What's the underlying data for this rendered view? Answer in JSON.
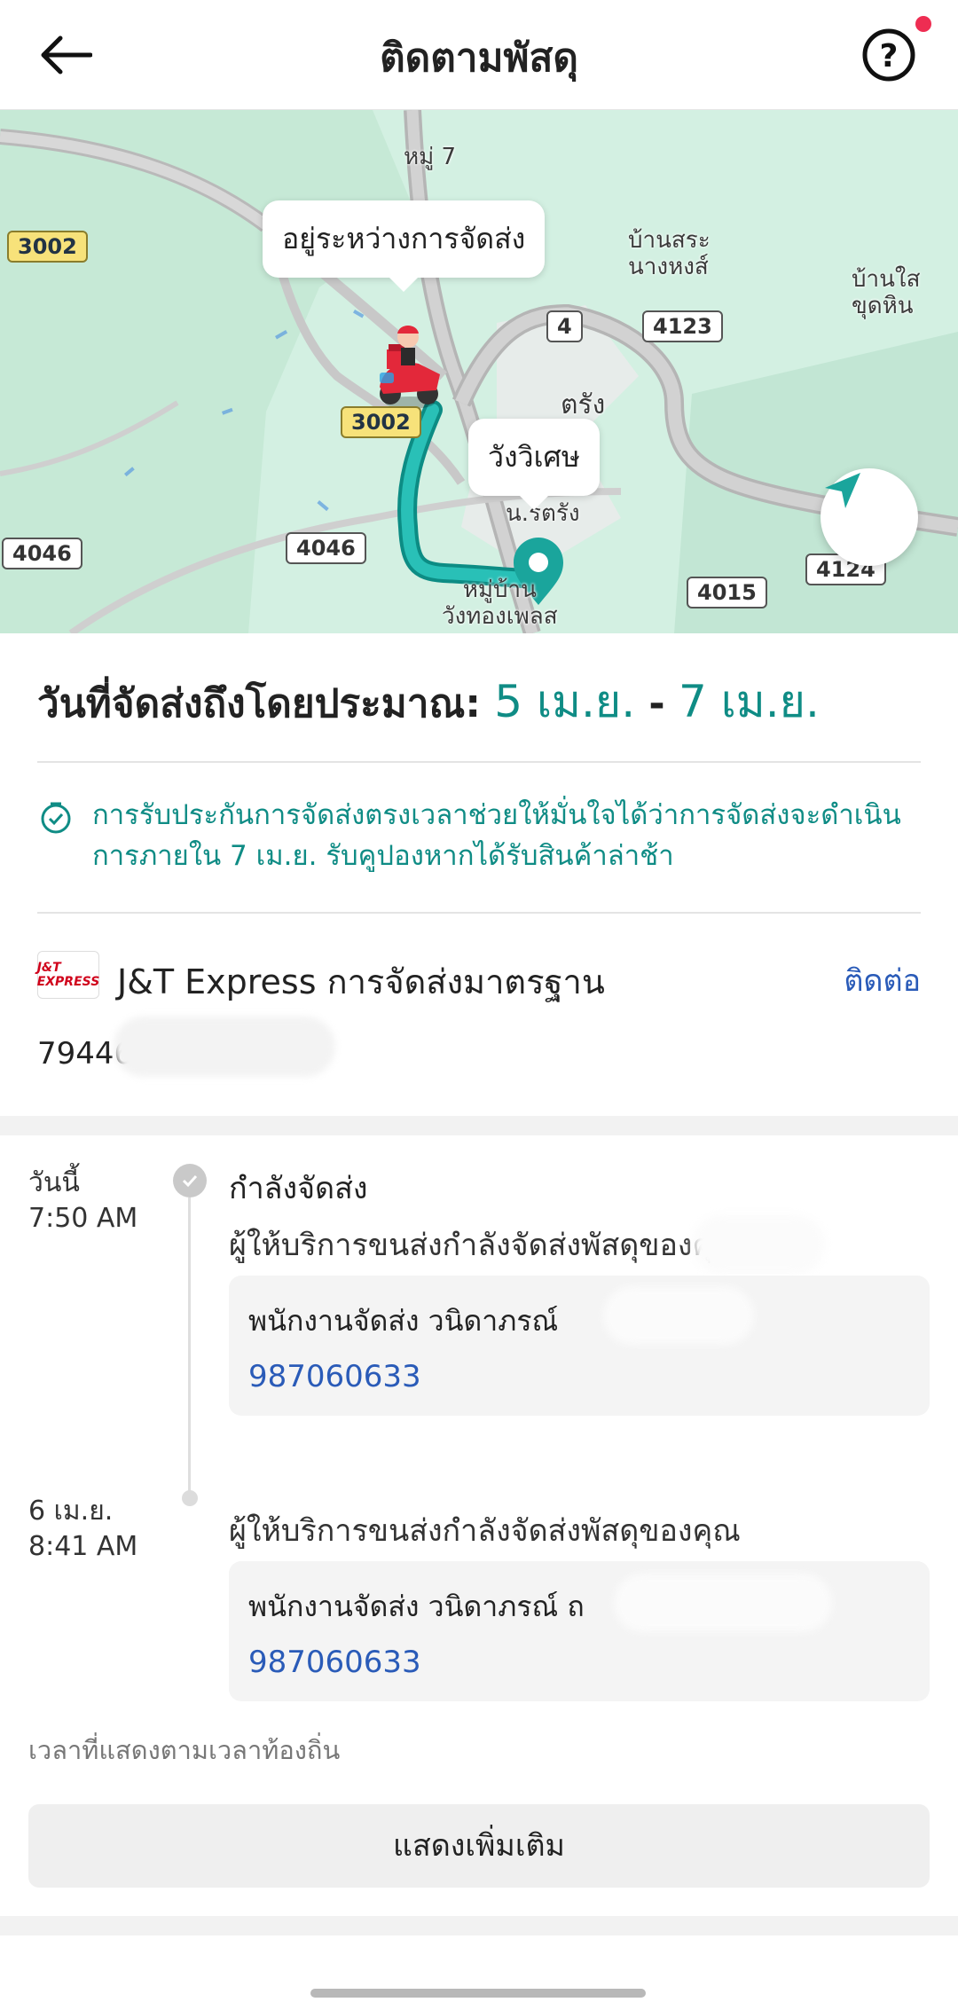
{
  "header": {
    "title": "ติดตามพัสดุ"
  },
  "map": {
    "status_bubble": "อยู่ระหว่างการจัดส่ง",
    "destination_bubble": "วังวิเศษ",
    "places": [
      "หมู่ 7",
      "บ้านสระ\nนางหงส์",
      "บ้านใส\nขุดหิน",
      "ตรัง",
      "น.รตรัง",
      "หมู่บ้าน\nวังทองเพลส"
    ],
    "roads": [
      "3002",
      "4123",
      "3002",
      "4046",
      "4046",
      "4015",
      "4124",
      "4"
    ]
  },
  "delivery": {
    "label": "วันที่จัดส่งถึงโดยประมาณ:",
    "from": "5 เม.ย.",
    "sep": " - ",
    "to": "7 เม.ย.",
    "guarantee": "การรับประกันการจัดส่งตรงเวลาช่วยให้มั่นใจได้ว่าการจัดส่งจะดำเนินการภายใน 7 เม.ย. รับคูปองหากได้รับสินค้าล่าช้า"
  },
  "courier": {
    "logo_text": "J&T EXPRESS",
    "name": "J&T Express การจัดส่งมาตรฐาน",
    "contact": "ติดต่อ",
    "tracking": "79446"
  },
  "timeline": [
    {
      "date": "วันนี้",
      "time": "7:50 AM",
      "status": "กำลังจัดส่ง",
      "description": "ผู้ให้บริการขนส่งกำลังจัดส่งพัสดุของคุณ",
      "courier_line": "พนักงานจัดส่ง  วนิดาภรณ์",
      "phone": "987060633"
    },
    {
      "date": "6 เม.ย.",
      "time": "8:41 AM",
      "description": "ผู้ให้บริการขนส่งกำลังจัดส่งพัสดุของคุณ",
      "courier_line": "พนักงานจัดส่ง  วนิดาภรณ์ ถ",
      "phone": "987060633"
    }
  ],
  "footer": {
    "note": "เวลาที่แสดงตามเวลาท้องถิ่น",
    "more_button": "แสดงเพิ่มเติม"
  },
  "colors": {
    "accent": "#0f8c85",
    "link": "#2a5bb8",
    "notification": "#ee2d52"
  }
}
